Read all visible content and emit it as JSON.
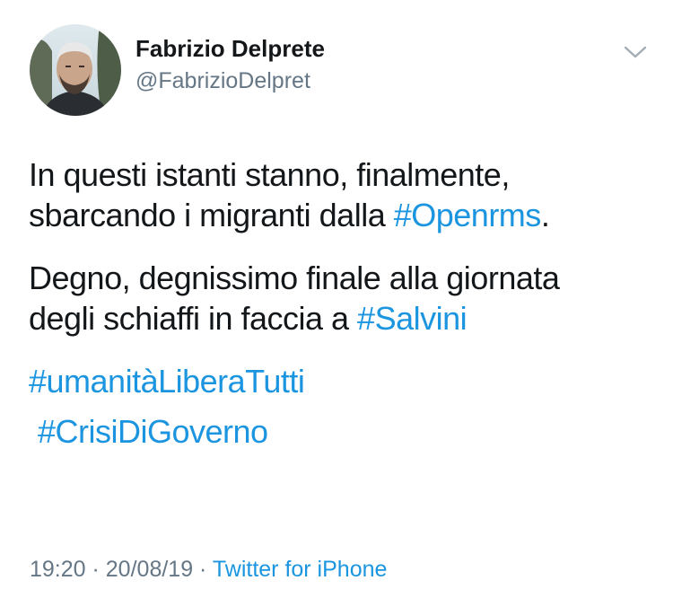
{
  "author": {
    "display_name": "Fabrizio Delprete",
    "handle": "@FabrizioDelpret"
  },
  "tweet": {
    "para1": {
      "line1": "In questi istanti stanno, finalmente,",
      "line2_text": "sbarcando i migranti dalla ",
      "line2_tag": "#Openrms",
      "line2_end": "."
    },
    "para2": {
      "line1": "Degno, degnissimo finale alla giornata",
      "line2_text": "degli schiaffi in faccia a ",
      "line2_tag": "#Salvini"
    },
    "hashtags": [
      "#umanitàLiberaTutti",
      "#CrisiDiGoverno"
    ]
  },
  "meta": {
    "time": "19:20",
    "separator1": " · ",
    "date": "20/08/19",
    "separator2": " · ",
    "source": "Twitter for iPhone"
  },
  "colors": {
    "link": "#1b95e0",
    "text": "#14171a",
    "secondary": "#657786"
  },
  "icons": {
    "menu": "chevron-down-icon",
    "avatar": "avatar"
  }
}
